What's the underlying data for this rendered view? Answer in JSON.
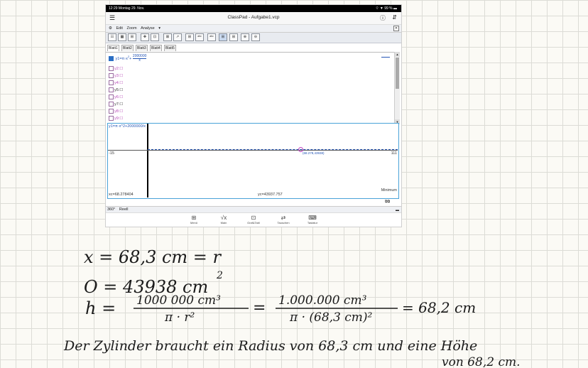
{
  "status_bar": {
    "left": "12:29  Montag 29. Nov.",
    "right": "⌔ ▼ 99 % ▬"
  },
  "app": {
    "title": "ClassPad - Aufgabe1.vcp",
    "menu": [
      "⚙",
      "Edit",
      "Zoom",
      "Analyse",
      "▾"
    ],
    "close": "✕",
    "toolbar_glyphs": [
      "☷",
      "▦",
      "⊞",
      "✥",
      "⊡",
      "⊠",
      "↗",
      "⊞",
      "ᵃᵇᶜ",
      "ᵃᵇᶜ",
      "⊞",
      "⊞",
      "⊕",
      "⊖"
    ],
    "tabs": [
      "Blatt1",
      "Blatt2",
      "Blatt3",
      "Blatt4",
      "Blatt5"
    ],
    "functions": [
      {
        "name": "y1=π·x",
        "exp": "2",
        "plus": "+",
        "num": "2000000",
        "den": "x",
        "checked": true
      },
      {
        "name": "y2:",
        "value": "☐",
        "checked": false
      },
      {
        "name": "y3:",
        "value": "☐",
        "checked": false
      },
      {
        "name": "y4:",
        "value": "☐",
        "checked": false
      },
      {
        "name": "y5:",
        "value": "☐",
        "checked": false
      },
      {
        "name": "y6:",
        "value": "☐",
        "checked": false
      },
      {
        "name": "y7:",
        "value": "☐",
        "checked": false
      },
      {
        "name": "y8:",
        "value": "☐",
        "checked": false
      },
      {
        "name": "y9:",
        "value": "☐",
        "checked": false
      }
    ],
    "graph": {
      "formula": "y1=π·x^2+2000000/x",
      "x_min_label": "-15",
      "x_max_label": "111",
      "point_label": "(68.278,43938)",
      "xc": "xc=68.278404",
      "yc": "yc=43937.757",
      "mode": "Minimum"
    },
    "statusbar": {
      "angle": "360°",
      "domain": "Reell"
    },
    "dock": [
      {
        "label": "Menü",
        "icon": "⊞"
      },
      {
        "label": "Main",
        "icon": "√x"
      },
      {
        "label": "Graf&Tabl",
        "icon": "⊡"
      },
      {
        "label": "Tauschen",
        "icon": "⇄"
      },
      {
        "label": "Tastatur",
        "icon": "⌨"
      }
    ]
  },
  "notes": {
    "line1": "x = 68,3 cm = r",
    "line2_a": "O = 43938 cm",
    "line2_exp": "2",
    "line3_lhs": "h =",
    "frac1_num": "1000 000 cm³",
    "frac1_den": "π · r²",
    "eq": "=",
    "frac2_num": "1.000.000 cm³",
    "frac2_den": "π · (68,3 cm)²",
    "result": "= 68,2 cm",
    "sentence1": "Der Zylinder braucht ein Radius von 68,3 cm und eine Höhe",
    "sentence2": "von 68,2 cm."
  }
}
